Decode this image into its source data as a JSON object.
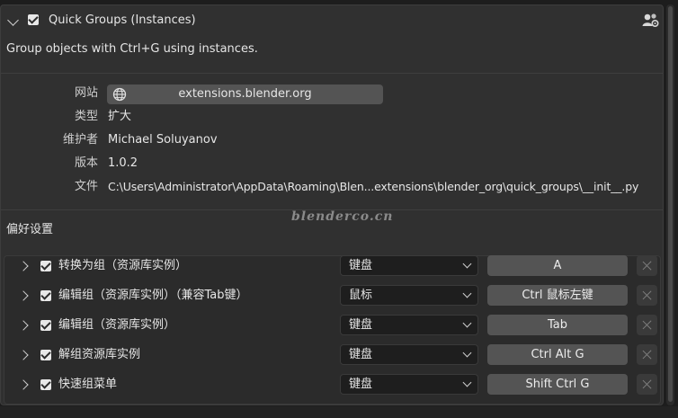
{
  "addon": {
    "title": "Quick Groups (Instances)",
    "description": "Group objects with Ctrl+G using instances.",
    "enabled": true
  },
  "info": {
    "website_label": "网站",
    "website_value": "extensions.blender.org",
    "type_label": "类型",
    "type_value": "扩大",
    "maintainer_label": "维护者",
    "maintainer_value": "Michael Soluyanov",
    "version_label": "版本",
    "version_value": "1.0.2",
    "file_label": "文件",
    "file_value": "C:\\Users\\Administrator\\AppData\\Roaming\\Blen...extensions\\blender_org\\quick_groups\\__init__.py"
  },
  "watermark": "blenderco.cn",
  "preferences": {
    "title": "偏好设置",
    "keymaps": [
      {
        "name": "转换为组（资源库实例）",
        "input_type": "键盘",
        "key": "A",
        "enabled": true
      },
      {
        "name": "编辑组（资源库实例）（兼容Tab键）",
        "input_type": "鼠标",
        "key": "Ctrl 鼠标左键",
        "enabled": true
      },
      {
        "name": "编辑组（资源库实例）",
        "input_type": "键盘",
        "key": "Tab",
        "enabled": true
      },
      {
        "name": "解组资源库实例",
        "input_type": "键盘",
        "key": "Ctrl Alt G",
        "enabled": true
      },
      {
        "name": "快速组菜单",
        "input_type": "键盘",
        "key": "Shift Ctrl G",
        "enabled": true
      }
    ]
  },
  "icons": {
    "expand": "chevron-down-icon",
    "user": "user-settings-icon",
    "web": "globe-icon",
    "row_expand": "chevron-right-icon",
    "remove": "close-icon"
  }
}
